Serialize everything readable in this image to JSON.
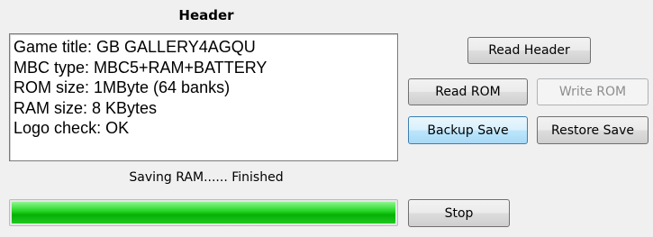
{
  "header": {
    "title": "Header",
    "lines": [
      "Game title: GB GALLERY4AGQU",
      "MBC type: MBC5+RAM+BATTERY",
      "ROM size: 1MByte (64 banks)",
      "RAM size: 8 KBytes",
      "Logo check: OK"
    ]
  },
  "buttons": {
    "read_header": "Read Header",
    "read_rom": "Read ROM",
    "write_rom": "Write ROM",
    "backup_save": "Backup Save",
    "restore_save": "Restore Save",
    "stop": "Stop"
  },
  "status": {
    "text": "Saving RAM...... Finished",
    "progress_percent": 100
  },
  "colors": {
    "progress_fill": "#06b006",
    "window_background": "#f0f0f0"
  }
}
